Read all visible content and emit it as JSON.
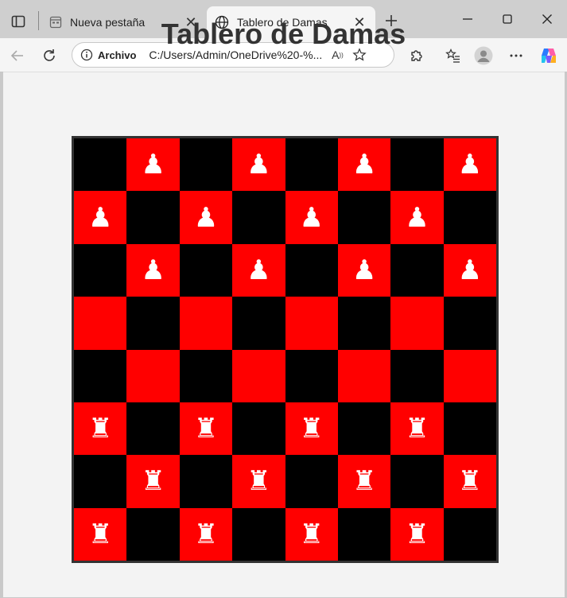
{
  "browser": {
    "tabs": [
      {
        "title": "Nueva pestaña",
        "icon": "new-tab-page-icon"
      },
      {
        "title": "Tablero de Damas",
        "icon": "globe-icon"
      }
    ],
    "address": {
      "scheme_label": "Archivo",
      "url": "C:/Users/Admin/OneDrive%20-%..."
    }
  },
  "page": {
    "title": "Tablero de Damas"
  },
  "board": {
    "colors": {
      "light": "#ff0000",
      "dark": "#000000",
      "piece": "#ffffff"
    },
    "rows": [
      [
        "",
        "♟",
        "",
        "♟",
        "",
        "♟",
        "",
        "♟"
      ],
      [
        "♟",
        "",
        "♟",
        "",
        "♟",
        "",
        "♟",
        ""
      ],
      [
        "",
        "♟",
        "",
        "♟",
        "",
        "♟",
        "",
        "♟"
      ],
      [
        "",
        "",
        "",
        "",
        "",
        "",
        "",
        ""
      ],
      [
        "",
        "",
        "",
        "",
        "",
        "",
        "",
        ""
      ],
      [
        "♜",
        "",
        "♜",
        "",
        "♜",
        "",
        "♜",
        ""
      ],
      [
        "",
        "♜",
        "",
        "♜",
        "",
        "♜",
        "",
        "♜"
      ],
      [
        "♜",
        "",
        "♜",
        "",
        "♜",
        "",
        "♜",
        ""
      ]
    ]
  }
}
